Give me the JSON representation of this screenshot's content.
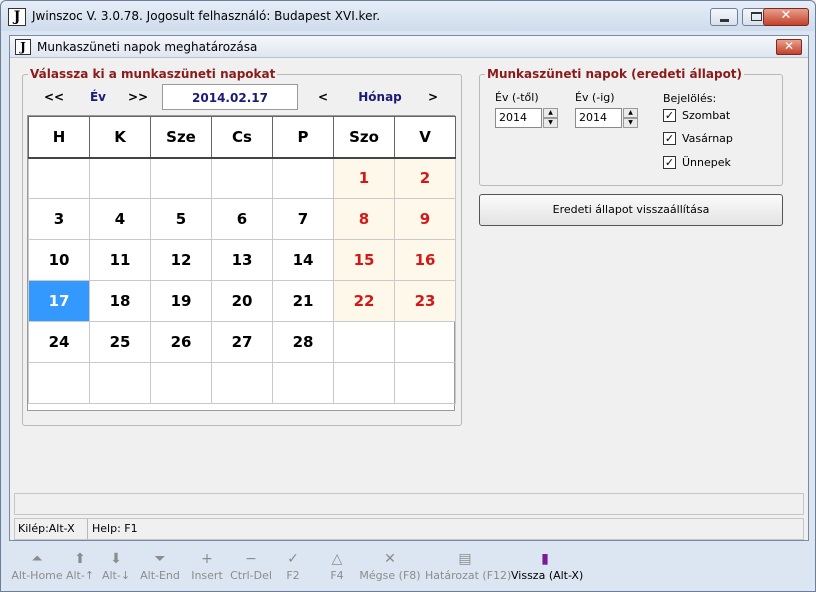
{
  "window": {
    "icon_letter": "J",
    "title": "Jwinszoc V. 3.0.78.  Jogosult felhasználó: Budapest XVI.ker."
  },
  "child": {
    "icon_letter": "J",
    "title": "Munkaszüneti napok meghatározása"
  },
  "calendar": {
    "legend": "Válassza ki a munkaszüneti napokat",
    "year_prev": "<<",
    "year_label": "Év",
    "year_next": ">>",
    "date": "2014.02.17",
    "month_prev": "<",
    "month_label": "Hónap",
    "month_next": ">",
    "headers": [
      "H",
      "K",
      "Sze",
      "Cs",
      "P",
      "Szo",
      "V"
    ],
    "rows": [
      [
        "",
        "",
        "",
        "",
        "",
        "1",
        "2"
      ],
      [
        "3",
        "4",
        "5",
        "6",
        "7",
        "8",
        "9"
      ],
      [
        "10",
        "11",
        "12",
        "13",
        "14",
        "15",
        "16"
      ],
      [
        "17",
        "18",
        "19",
        "20",
        "21",
        "22",
        "23"
      ],
      [
        "24",
        "25",
        "26",
        "27",
        "28",
        "",
        ""
      ],
      [
        "",
        "",
        "",
        "",
        "",
        "",
        ""
      ]
    ],
    "selected": "17"
  },
  "original_state": {
    "legend": "Munkaszüneti napok (eredeti állapot)",
    "year_from_label": "Év (-től)",
    "year_from_value": "2014",
    "year_to_label": "Év (-ig)",
    "year_to_value": "2014",
    "marking_label": "Bejelölés:",
    "checkboxes": [
      {
        "label": "Szombat",
        "checked": true
      },
      {
        "label": "Vasárnap",
        "checked": true
      },
      {
        "label": "Ünnepek",
        "checked": true
      }
    ],
    "reset_button": "Eredeti állapot visszaállítása"
  },
  "statusbar": {
    "exit": "Kilép:Alt-X",
    "help": "Help: F1"
  },
  "toolbar": [
    {
      "label": "Alt-Home",
      "icon": "first-icon"
    },
    {
      "label": "Alt-↑",
      "icon": "up-arrow-icon"
    },
    {
      "label": "Alt-↓",
      "icon": "down-arrow-icon"
    },
    {
      "label": "Alt-End",
      "icon": "last-icon"
    },
    {
      "label": "Insert",
      "icon": "plus-icon"
    },
    {
      "label": "Ctrl-Del",
      "icon": "minus-icon"
    },
    {
      "label": "F2",
      "icon": "check-icon"
    },
    {
      "label": "F4",
      "icon": "triangle-icon"
    },
    {
      "label": "Mégse (F8)",
      "icon": "cross-icon"
    },
    {
      "label": "Határozat (F12)",
      "icon": "printer-icon"
    },
    {
      "label": "Vissza (Alt-X)",
      "icon": "door-exit-icon"
    }
  ]
}
